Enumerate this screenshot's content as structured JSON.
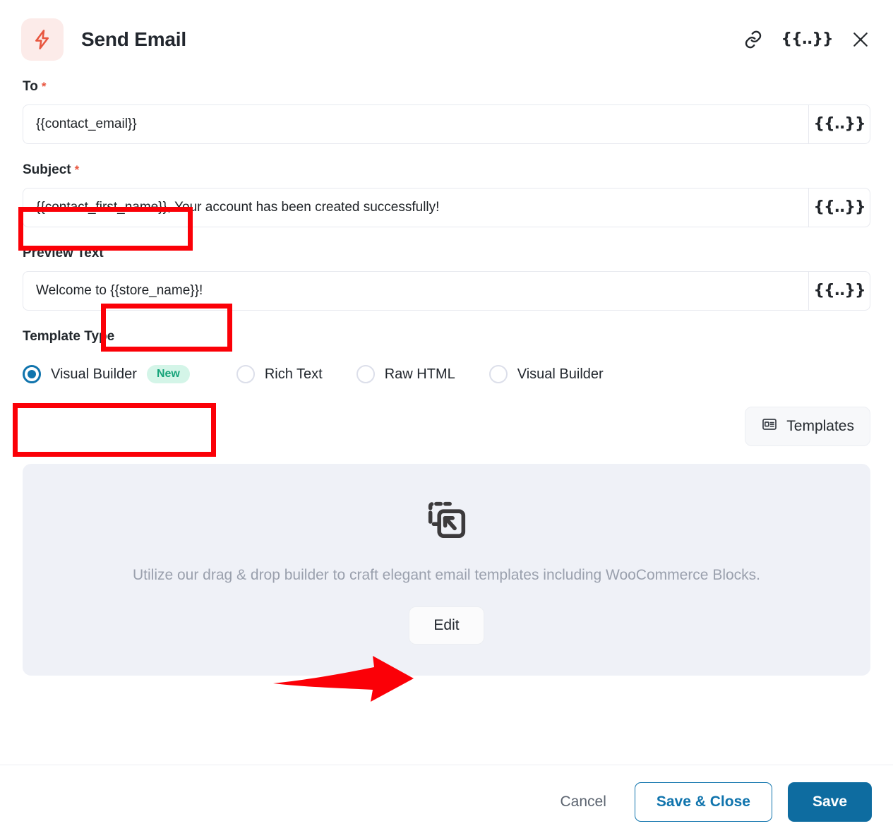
{
  "header": {
    "title": "Send Email",
    "app_icon": "lightning-bolt-icon",
    "icon_bg_color": "#fcebe9",
    "icon_color": "#e8563f",
    "actions": [
      {
        "name": "link-icon",
        "label": ""
      },
      {
        "name": "merge-tag-icon",
        "label": "{{..}}"
      },
      {
        "name": "close-icon",
        "label": ""
      }
    ]
  },
  "fields": {
    "to": {
      "label": "To",
      "required_marker": "*",
      "value": "{{contact_email}}",
      "placeholder": "",
      "merge_tag_label": "{{..}}"
    },
    "subject": {
      "label": "Subject",
      "required_marker": "*",
      "value": "{{contact_first_name}}, Your account has been created successfully!",
      "placeholder": "",
      "merge_tag_label": "{{..}}"
    },
    "preview_text": {
      "label": "Preview Text",
      "required_marker": "",
      "value": "Welcome to {{store_name}}!",
      "placeholder": "",
      "merge_tag_label": "{{..}}"
    }
  },
  "template_type": {
    "label": "Template Type",
    "selected_index": 0,
    "options": [
      {
        "label": "Visual Builder",
        "badge": "New",
        "selected": true
      },
      {
        "label": "Rich Text",
        "badge": "",
        "selected": false
      },
      {
        "label": "Raw HTML",
        "badge": "",
        "selected": false
      },
      {
        "label": "Visual Builder",
        "badge": "",
        "selected": false
      }
    ],
    "badge_bg_color": "#d4f5e8",
    "badge_text_color": "#16a47a",
    "radio_selected_color": "#1074ad"
  },
  "templates_button": {
    "label": "Templates",
    "icon": "article-layout-icon"
  },
  "drop_area": {
    "icon": "drag-drop-icon",
    "description": "Utilize our drag & drop builder to craft elegant email templates including WooCommerce Blocks.",
    "edit_button_label": "Edit",
    "bg_color": "#eff1f7"
  },
  "footer": {
    "cancel_label": "Cancel",
    "save_close_label": "Save & Close",
    "save_label": "Save",
    "primary_color": "#0e6ca0"
  },
  "annotations": {
    "color": "#fb0007",
    "boxes": [
      {
        "name": "subject-merge-tag-highlight",
        "target": "subject field merge tag"
      },
      {
        "name": "preview-merge-tag-highlight",
        "target": "preview text merge tag"
      },
      {
        "name": "visual-builder-option-highlight",
        "target": "Visual Builder radio option"
      }
    ],
    "arrows": [
      {
        "name": "edit-button-arrow",
        "target": "Edit button",
        "direction": "right"
      }
    ]
  }
}
